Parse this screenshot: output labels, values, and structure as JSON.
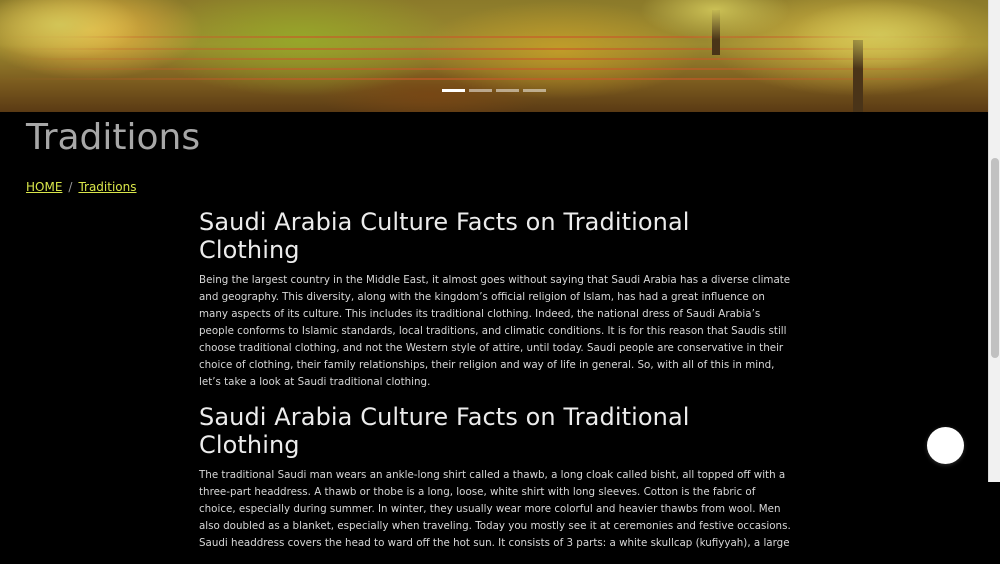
{
  "carousel": {
    "slides": [
      {
        "label": "Slide 1",
        "active": true
      },
      {
        "label": "Slide 2",
        "active": false
      },
      {
        "label": "Slide 3",
        "active": false
      },
      {
        "label": "Slide 4",
        "active": false
      }
    ]
  },
  "page": {
    "title": "Traditions"
  },
  "breadcrumb": {
    "home": "HOME",
    "separator": "/",
    "current": "Traditions"
  },
  "article": {
    "sections": [
      {
        "heading": "Saudi Arabia Culture Facts on Traditional Clothing",
        "body": "Being the largest country in the Middle East, it almost goes without saying that Saudi Arabia has a diverse climate and geography. This diversity, along with the kingdom’s official religion of Islam, has had a great influence on many aspects of its culture. This includes its traditional clothing. Indeed, the national dress of Saudi Arabia’s people conforms to Islamic standards, local traditions, and climatic conditions. It is for this reason that Saudis still choose traditional clothing, and not the Western style of attire, until today. Saudi people are conservative in their choice of clothing, their family relationships, their religion and way of life in general. So, with all of this in mind, let’s take a look at Saudi traditional clothing."
      },
      {
        "heading": "Saudi Arabia Culture Facts on Traditional Clothing",
        "body": "The traditional Saudi man wears an ankle-long shirt called a thawb, a long cloak called bisht, all topped off with a three-part headdress. A thawb or thobe is a long, loose, white shirt with long sleeves. Cotton is the fabric of choice, especially during summer. In winter, they usually wear more colorful and heavier thawbs from wool. Men also doubled as a blanket, especially when traveling. Today you mostly see it at ceremonies and festive occasions. Saudi headdress covers the head to ward off the hot sun. It consists of 3 parts: a white skullcap (kufiyyah), a large"
      }
    ]
  },
  "colors": {
    "background": "#000000",
    "link": "#d9e64a",
    "title": "#a7a7a7"
  }
}
